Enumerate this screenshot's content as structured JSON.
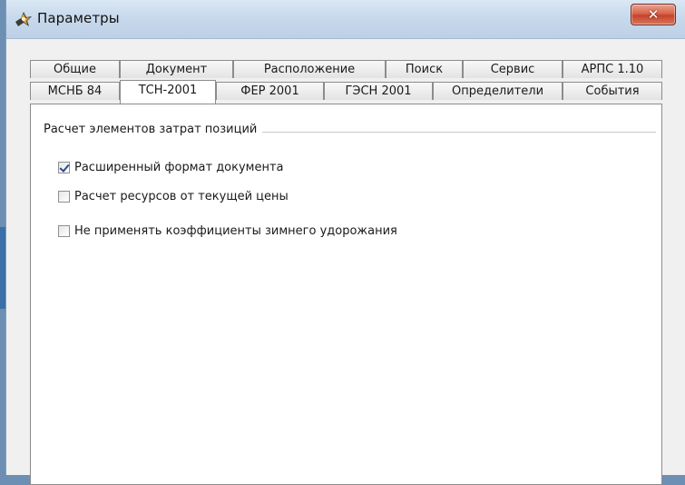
{
  "window": {
    "title": "Параметры",
    "close_glyph": "✕"
  },
  "tabs": {
    "row_back": [
      {
        "label": "Общие"
      },
      {
        "label": "Документ"
      },
      {
        "label": "Расположение"
      },
      {
        "label": "Поиск"
      },
      {
        "label": "Сервис"
      },
      {
        "label": "АРПС 1.10"
      }
    ],
    "row_front": [
      {
        "label": "МСНБ 84"
      },
      {
        "label": "ТСН-2001",
        "active": true
      },
      {
        "label": "ФЕР 2001"
      },
      {
        "label": "ГЭСН 2001"
      },
      {
        "label": "Определители"
      },
      {
        "label": "События"
      }
    ]
  },
  "panel": {
    "group_title": "Расчет элементов затрат позиций",
    "options": [
      {
        "label": "Расширенный формат документа",
        "checked": true
      },
      {
        "label": "Расчет ресурсов от текущей цены",
        "checked": false
      },
      {
        "label": "Не применять коэффициенты зимнего удорожания",
        "checked": false
      }
    ]
  },
  "icons": {
    "app": "parameters-app-icon",
    "close": "close-icon"
  }
}
